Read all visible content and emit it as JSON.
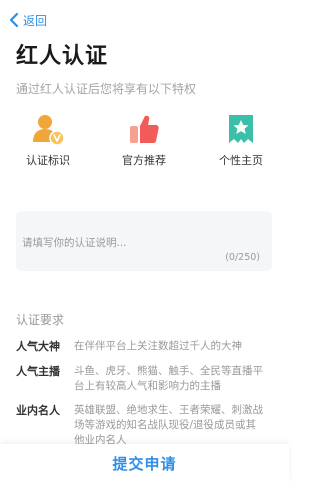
{
  "nav": {
    "back_label": "返回"
  },
  "header": {
    "title": "红人认证",
    "subtitle": "通过红人认证后您将享有以下特权"
  },
  "privileges": [
    {
      "label": "认证标识",
      "icon": "verified-user-icon",
      "color": "#f0a73a"
    },
    {
      "label": "官方推荐",
      "icon": "thumbs-up-icon",
      "color": "#f25b57"
    },
    {
      "label": "个性主页",
      "icon": "star-page-icon",
      "color": "#3bbfa8"
    }
  ],
  "form": {
    "description_placeholder": "请填写你的认证说明...",
    "description_value": "",
    "char_count": "(0/250)"
  },
  "requirements": {
    "heading": "认证要求",
    "items": [
      {
        "name": "人气大神",
        "desc": "在伴伴平台上关注数超过千人的大神"
      },
      {
        "name": "人气主播",
        "desc": "斗鱼、虎牙、熊猫、触手、全民等直播平台上有较高人气和影响力的主播"
      },
      {
        "name": "业内名人",
        "desc": "英雄联盟、绝地求生、王者荣耀、刺激战场等游戏的知名战队现役/退役成员或其他业内名人"
      }
    ]
  },
  "footer": {
    "submit_label": "提交申请"
  },
  "colors": {
    "accent": "#2f8fe8",
    "muted_text": "#9a9a9a"
  }
}
